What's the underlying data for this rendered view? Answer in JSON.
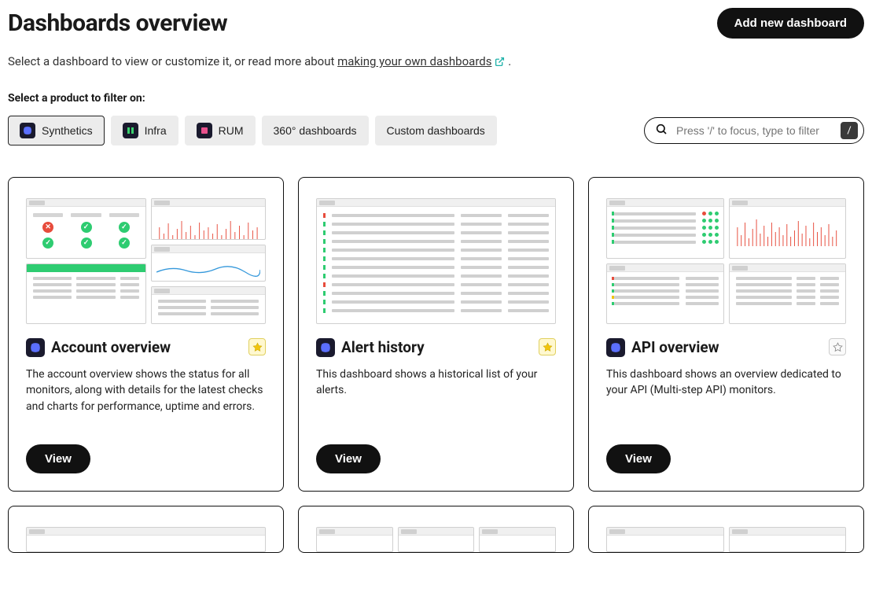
{
  "header": {
    "title": "Dashboards overview",
    "add_button": "Add new dashboard"
  },
  "intro": {
    "prefix": "Select a dashboard to view or customize it, or read more about ",
    "link_text": "making your own dashboards",
    "suffix": " ."
  },
  "filter": {
    "label": "Select a product to filter on:",
    "chips": [
      {
        "label": "Synthetics",
        "icon": "synthetics-icon",
        "active": true
      },
      {
        "label": "Infra",
        "icon": "infra-icon",
        "active": false
      },
      {
        "label": "RUM",
        "icon": "rum-icon",
        "active": false
      },
      {
        "label": "360° dashboards",
        "icon": null,
        "active": false
      },
      {
        "label": "Custom dashboards",
        "icon": null,
        "active": false
      }
    ]
  },
  "search": {
    "placeholder": "Press '/' to focus, type to filter",
    "key_hint": "/"
  },
  "cards": [
    {
      "title": "Account overview",
      "description": "The account overview shows the status for all monitors, along with details for the latest checks and charts for performance, uptime and errors.",
      "view_label": "View",
      "favorite": true
    },
    {
      "title": "Alert history",
      "description": "This dashboard shows a historical list of your alerts.",
      "view_label": "View",
      "favorite": true
    },
    {
      "title": "API overview",
      "description": "This dashboard shows an overview dedicated to your API (Multi-step API) monitors.",
      "view_label": "View",
      "favorite": false
    }
  ]
}
